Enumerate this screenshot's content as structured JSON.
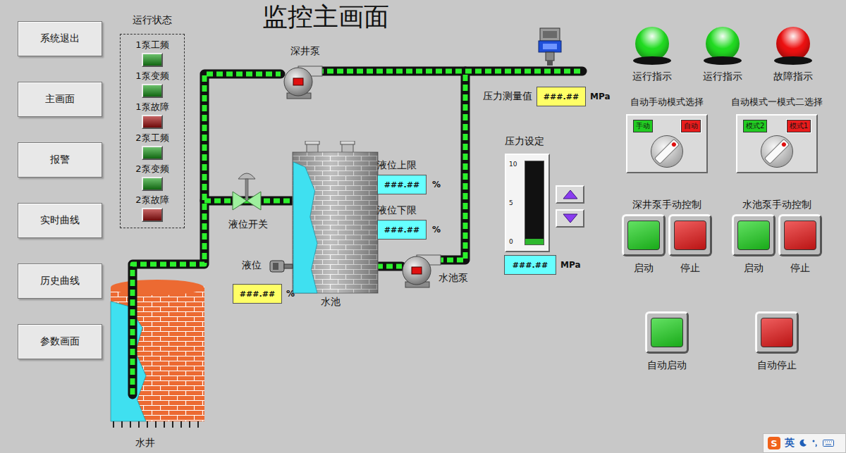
{
  "window": {
    "title": "监控主画面"
  },
  "nav": [
    "系统退出",
    "主画面",
    "报警",
    "实时曲线",
    "历史曲线",
    "参数画面"
  ],
  "status_panel": {
    "title": "运行状态",
    "items": [
      {
        "label": "1泵工频",
        "color": "#1c9e1c"
      },
      {
        "label": "1泵变频",
        "color": "#1c9e1c"
      },
      {
        "label": "1泵故障",
        "color": "#a81010"
      },
      {
        "label": "2泵工频",
        "color": "#1c9e1c"
      },
      {
        "label": "2泵变频",
        "color": "#1c9e1c"
      },
      {
        "label": "2泵故障",
        "color": "#a81010"
      }
    ]
  },
  "diagram": {
    "well": {
      "label": "水井",
      "level": 0.92
    },
    "deep_pump": {
      "label": "深井泵"
    },
    "valve": {
      "label": "液位开关"
    },
    "tank": {
      "label": "水池",
      "level": 0.95
    },
    "pool_pump": {
      "label": "水池泵"
    },
    "level_sensor": {
      "label": "液位",
      "value": "###.##",
      "unit": "%"
    },
    "level_limits": [
      {
        "label": "液位上限",
        "value": "###.##",
        "unit": "%"
      },
      {
        "label": "液位下限",
        "value": "###.##",
        "unit": "%"
      }
    ],
    "pressure_reading": {
      "label": "压力测量值",
      "value": "###.##",
      "unit": "MPa"
    },
    "pressure_setpoint": {
      "label": "压力设定",
      "ticks": [
        "10",
        "5",
        "0"
      ],
      "level": 0.07,
      "value": "###.##",
      "unit": "MPa"
    }
  },
  "lights": [
    {
      "label": "运行指示",
      "color": "#22dd22"
    },
    {
      "label": "运行指示",
      "color": "#22dd22"
    },
    {
      "label": "故障指示",
      "color": "#ee1111"
    }
  ],
  "selectors": [
    {
      "title": "自动手动模式选择",
      "options": [
        {
          "label": "手动",
          "color": "#22cc22",
          "selected": false
        },
        {
          "label": "自动",
          "color": "#e81c1c",
          "selected": true
        }
      ]
    },
    {
      "title": "自动模式一模式二选择",
      "options": [
        {
          "label": "模式2",
          "color": "#22cc22",
          "selected": false
        },
        {
          "label": "模式1",
          "color": "#e81c1c",
          "selected": true
        }
      ]
    }
  ],
  "manual_controls": [
    {
      "title": "深井泵手动控制",
      "buttons": [
        {
          "label": "启动",
          "color": "#1fd41f"
        },
        {
          "label": "停止",
          "color": "#e81818"
        }
      ]
    },
    {
      "title": "水池泵手动控制",
      "buttons": [
        {
          "label": "启动",
          "color": "#1fd41f"
        },
        {
          "label": "停止",
          "color": "#e81818"
        }
      ]
    }
  ],
  "auto_controls": [
    {
      "label": "自动启动",
      "color": "#1fd41f"
    },
    {
      "label": "自动停止",
      "color": "#e81818"
    }
  ],
  "ime": {
    "logo": "S",
    "language": "英"
  }
}
